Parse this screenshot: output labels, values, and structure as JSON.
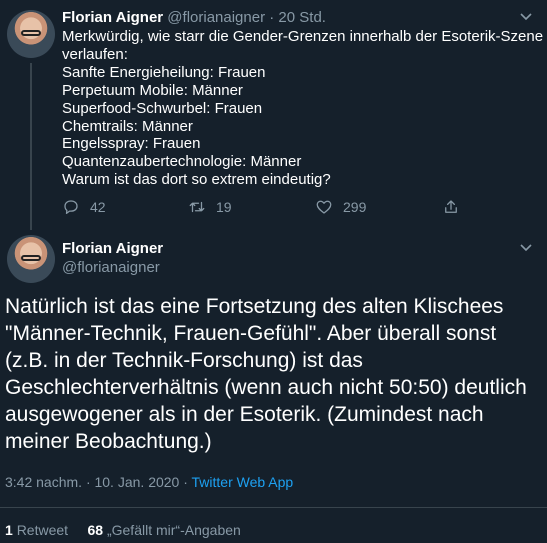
{
  "tweet1": {
    "name": "Florian Aigner",
    "handle": "@florianaigner",
    "separator": "·",
    "time": "20 Std.",
    "lines": [
      "Merkwürdig, wie starr die Gender-Grenzen innerhalb der Esoterik-Szene",
      "verlaufen:",
      "Sanfte Energieheilung: Frauen",
      "Perpetuum Mobile: Männer",
      "Superfood-Schwurbel: Frauen",
      "Chemtrails: Männer",
      "Engelsspray: Frauen",
      "Quantenzaubertechnologie: Männer",
      "Warum ist das dort so extrem eindeutig?"
    ],
    "replies": "42",
    "retweets": "19",
    "likes": "299"
  },
  "tweet2": {
    "name": "Florian Aigner",
    "handle": "@florianaigner",
    "lines": [
      "Natürlich ist das eine Fortsetzung des alten Klischees",
      "\"Männer-Technik, Frauen-Gefühl\". Aber überall sonst",
      "(z.B. in der Technik-Forschung) ist das",
      "Geschlechterverhältnis (wenn auch nicht 50:50) deutlich",
      "ausgewogener als in der Esoterik. (Zumindest nach",
      "meiner Beobachtung.)"
    ],
    "timestamp": "3:42 nachm. · 10. Jan. 2020 · ",
    "source": "Twitter Web App",
    "retweet_count": "1",
    "retweet_label": "Retweet",
    "like_count": "68",
    "like_label": "„Gefällt mir“-Angaben"
  },
  "colors": {
    "background": "#15202b",
    "text": "#ffffff",
    "muted": "#8899a6",
    "link": "#1da1f2",
    "border": "#38444d"
  }
}
